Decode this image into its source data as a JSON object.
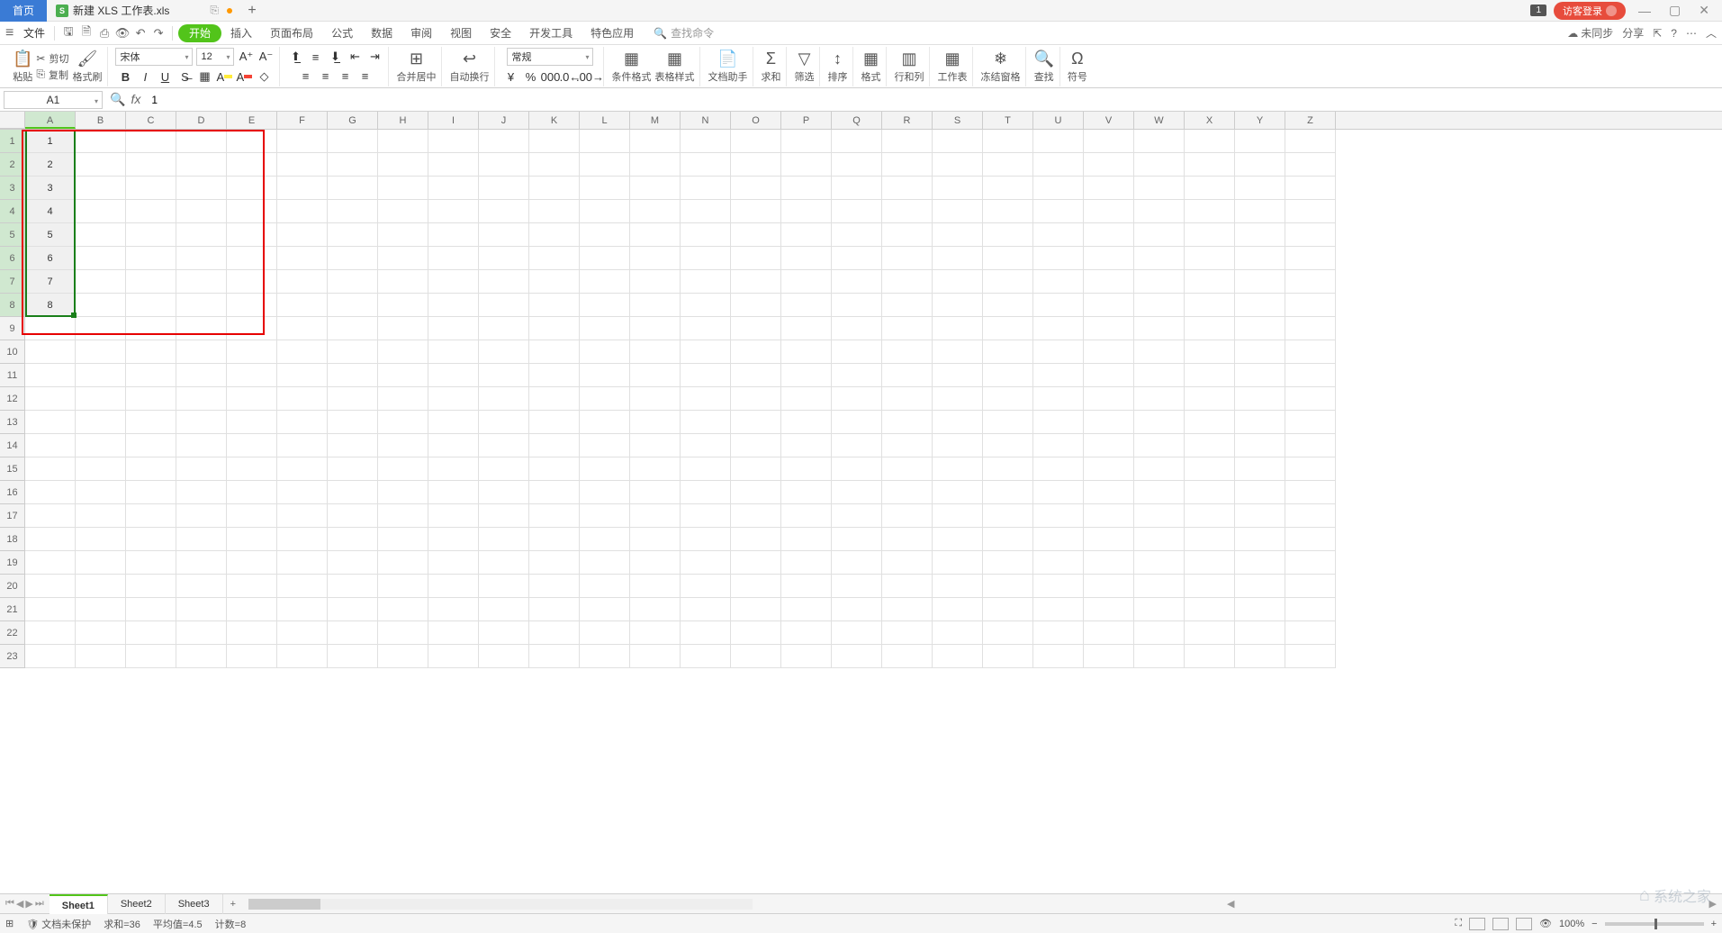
{
  "titlebar": {
    "home": "首页",
    "filename": "新建 XLS 工作表.xls",
    "badge": "1",
    "guest_login": "访客登录"
  },
  "menubar": {
    "file": "文件",
    "tabs": [
      "开始",
      "插入",
      "页面布局",
      "公式",
      "数据",
      "审阅",
      "视图",
      "安全",
      "开发工具",
      "特色应用"
    ],
    "search_placeholder": "查找命令",
    "sync": "未同步",
    "share": "分享"
  },
  "ribbon": {
    "paste": "粘贴",
    "cut": "剪切",
    "copy": "复制",
    "format_painter": "格式刷",
    "font": "宋体",
    "size": "12",
    "merge": "合并居中",
    "wrap": "自动换行",
    "numfmt": "常规",
    "cond_fmt": "条件格式",
    "table_style": "表格样式",
    "doc_helper": "文档助手",
    "sum": "求和",
    "filter": "筛选",
    "sort": "排序",
    "format": "格式",
    "rowcol": "行和列",
    "worksheet": "工作表",
    "freeze": "冻结窗格",
    "find": "查找",
    "symbol": "符号"
  },
  "fbar": {
    "name": "A1",
    "formula": "1"
  },
  "columns": [
    "A",
    "B",
    "C",
    "D",
    "E",
    "F",
    "G",
    "H",
    "I",
    "J",
    "K",
    "L",
    "M",
    "N",
    "O",
    "P",
    "Q",
    "R",
    "S",
    "T",
    "U",
    "V",
    "W",
    "X",
    "Y",
    "Z"
  ],
  "rows": 23,
  "cells": {
    "A1": "1",
    "A2": "2",
    "A3": "3",
    "A4": "4",
    "A5": "5",
    "A6": "6",
    "A7": "7",
    "A8": "8"
  },
  "selection": {
    "col": "A",
    "rowStart": 1,
    "rowEnd": 8
  },
  "sheets": {
    "list": [
      "Sheet1",
      "Sheet2",
      "Sheet3"
    ],
    "active": 0
  },
  "status": {
    "protect": "文档未保护",
    "sum": "求和=36",
    "avg": "平均值=4.5",
    "count": "计数=8",
    "zoom": "100%"
  },
  "watermark": "系统之家"
}
